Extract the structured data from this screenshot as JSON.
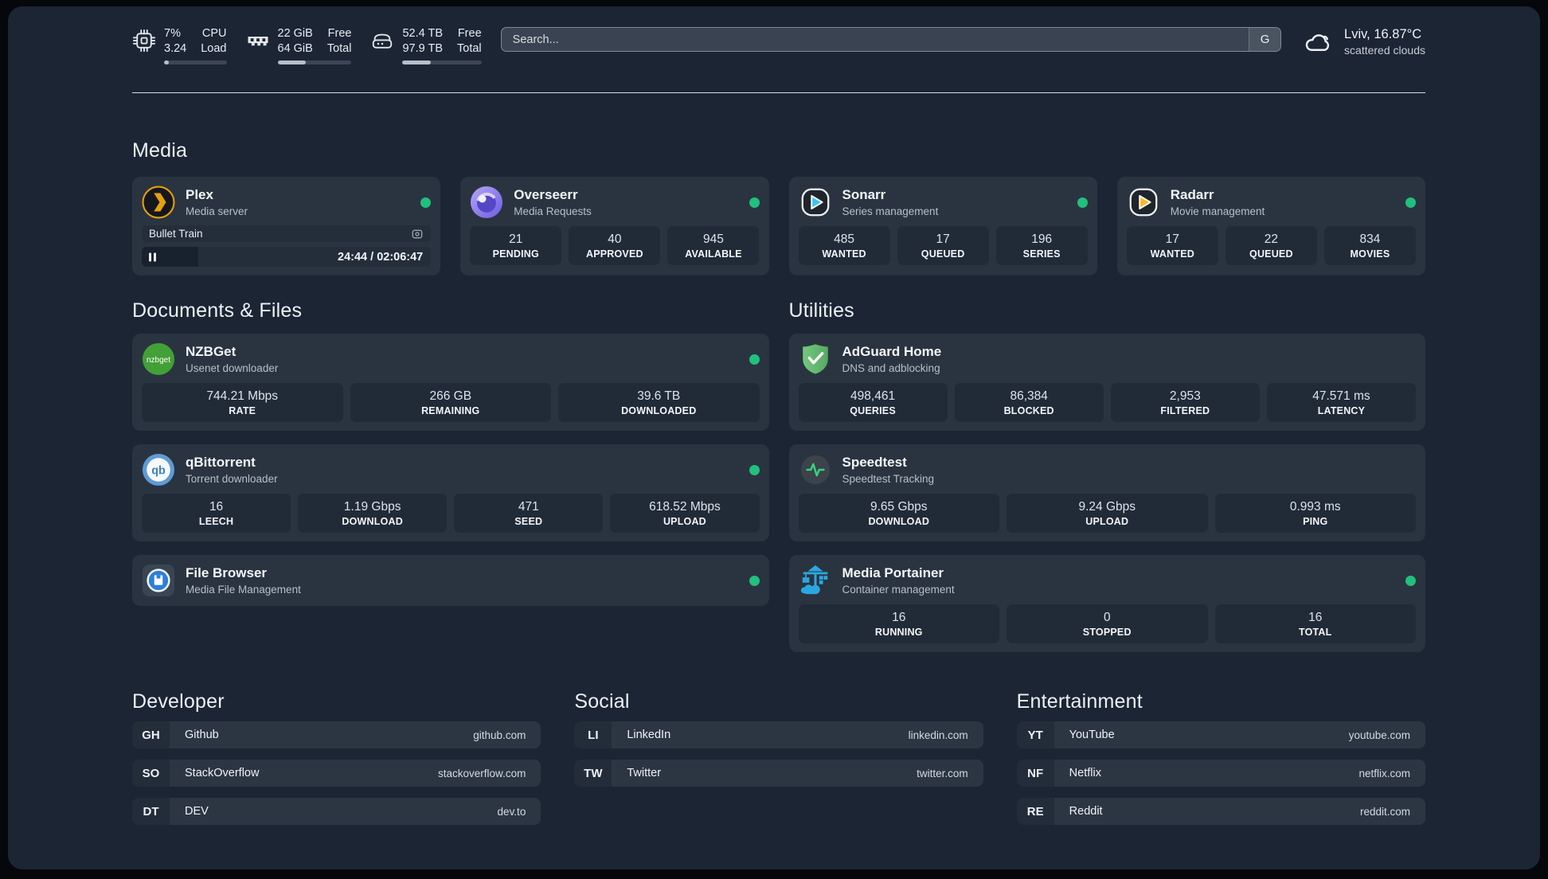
{
  "theme": {
    "background": "#1b2534",
    "card": "#2a3440",
    "stat_box": "#212b38",
    "online_green": "#21c07d",
    "plex_amber": "#e5a00d",
    "portainer_blue": "#2ba7e0"
  },
  "header": {
    "system_stats": [
      {
        "name": "cpu",
        "icon": "cpu-icon",
        "value1": "7%",
        "value2": "3.24",
        "label1": "CPU",
        "label2": "Load",
        "progress_pct": 8
      },
      {
        "name": "memory",
        "icon": "ram-icon",
        "value1": "22 GiB",
        "value2": "64 GiB",
        "label1": "Free",
        "label2": "Total",
        "progress_pct": 38
      },
      {
        "name": "disk",
        "icon": "disk-icon",
        "value1": "52.4 TB",
        "value2": "97.9 TB",
        "label1": "Free",
        "label2": "Total",
        "progress_pct": 36
      }
    ],
    "search": {
      "placeholder": "Search...",
      "engine_label": "G"
    },
    "weather": {
      "location_temp": "Lviv, 16.87°C",
      "condition": "scattered clouds"
    }
  },
  "sections": {
    "media": {
      "title": "Media",
      "apps": [
        {
          "name": "Plex",
          "description": "Media server",
          "icon": "plex-icon",
          "online": true,
          "now_playing": {
            "title": "Bullet Train",
            "time": "24:44 / 02:06:47",
            "progress_pct": 19.5,
            "state": "paused"
          }
        },
        {
          "name": "Overseerr",
          "description": "Media Requests",
          "icon": "overseerr-icon",
          "online": true,
          "stats": [
            {
              "value": "21",
              "label": "PENDING"
            },
            {
              "value": "40",
              "label": "APPROVED"
            },
            {
              "value": "945",
              "label": "AVAILABLE"
            }
          ]
        },
        {
          "name": "Sonarr",
          "description": "Series management",
          "icon": "sonarr-icon",
          "online": true,
          "stats": [
            {
              "value": "485",
              "label": "WANTED"
            },
            {
              "value": "17",
              "label": "QUEUED"
            },
            {
              "value": "196",
              "label": "SERIES"
            }
          ]
        },
        {
          "name": "Radarr",
          "description": "Movie management",
          "icon": "radarr-icon",
          "online": true,
          "stats": [
            {
              "value": "17",
              "label": "WANTED"
            },
            {
              "value": "22",
              "label": "QUEUED"
            },
            {
              "value": "834",
              "label": "MOVIES"
            }
          ]
        }
      ]
    },
    "documents": {
      "title": "Documents & Files",
      "apps": [
        {
          "name": "NZBGet",
          "description": "Usenet downloader",
          "icon": "nzbget-icon",
          "online": true,
          "stats": [
            {
              "value": "744.21 Mbps",
              "label": "RATE"
            },
            {
              "value": "266 GB",
              "label": "REMAINING"
            },
            {
              "value": "39.6 TB",
              "label": "DOWNLOADED"
            }
          ]
        },
        {
          "name": "qBittorrent",
          "description": "Torrent downloader",
          "icon": "qbittorrent-icon",
          "online": true,
          "stats": [
            {
              "value": "16",
              "label": "LEECH"
            },
            {
              "value": "1.19 Gbps",
              "label": "DOWNLOAD"
            },
            {
              "value": "471",
              "label": "SEED"
            },
            {
              "value": "618.52 Mbps",
              "label": "UPLOAD"
            }
          ]
        },
        {
          "name": "File Browser",
          "description": "Media File Management",
          "icon": "filebrowser-icon",
          "online": true,
          "stats": []
        }
      ]
    },
    "utilities": {
      "title": "Utilities",
      "apps": [
        {
          "name": "AdGuard Home",
          "description": "DNS and adblocking",
          "icon": "adguard-icon",
          "online": false,
          "stats": [
            {
              "value": "498,461",
              "label": "QUERIES"
            },
            {
              "value": "86,384",
              "label": "BLOCKED"
            },
            {
              "value": "2,953",
              "label": "FILTERED"
            },
            {
              "value": "47.571 ms",
              "label": "LATENCY"
            }
          ]
        },
        {
          "name": "Speedtest",
          "description": "Speedtest Tracking",
          "icon": "speedtest-icon",
          "online": false,
          "stats": [
            {
              "value": "9.65 Gbps",
              "label": "DOWNLOAD"
            },
            {
              "value": "9.24 Gbps",
              "label": "UPLOAD"
            },
            {
              "value": "0.993 ms",
              "label": "PING"
            }
          ]
        },
        {
          "name": "Media Portainer",
          "description": "Container management",
          "icon": "portainer-icon",
          "online": true,
          "stats": [
            {
              "value": "16",
              "label": "RUNNING"
            },
            {
              "value": "0",
              "label": "STOPPED"
            },
            {
              "value": "16",
              "label": "TOTAL"
            }
          ]
        }
      ]
    },
    "links": [
      {
        "title": "Developer",
        "items": [
          {
            "abbr": "GH",
            "name": "Github",
            "url": "github.com"
          },
          {
            "abbr": "SO",
            "name": "StackOverflow",
            "url": "stackoverflow.com"
          },
          {
            "abbr": "DT",
            "name": "DEV",
            "url": "dev.to"
          }
        ]
      },
      {
        "title": "Social",
        "items": [
          {
            "abbr": "LI",
            "name": "LinkedIn",
            "url": "linkedin.com"
          },
          {
            "abbr": "TW",
            "name": "Twitter",
            "url": "twitter.com"
          }
        ]
      },
      {
        "title": "Entertainment",
        "items": [
          {
            "abbr": "YT",
            "name": "YouTube",
            "url": "youtube.com"
          },
          {
            "abbr": "NF",
            "name": "Netflix",
            "url": "netflix.com"
          },
          {
            "abbr": "RE",
            "name": "Reddit",
            "url": "reddit.com"
          }
        ]
      }
    ]
  }
}
